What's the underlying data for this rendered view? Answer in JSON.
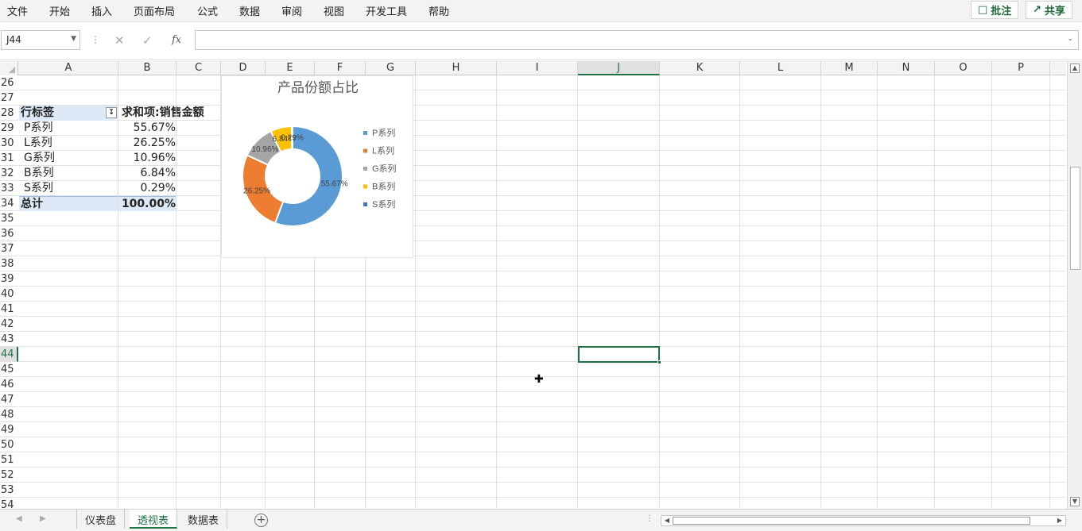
{
  "menu": {
    "items": [
      "文件",
      "开始",
      "插入",
      "页面布局",
      "公式",
      "数据",
      "审阅",
      "视图",
      "开发工具",
      "帮助"
    ],
    "comment_label": "批注",
    "share_label": "共享"
  },
  "formula_bar": {
    "name_box": "J44",
    "fx_label": "fx",
    "formula_value": ""
  },
  "columns": [
    "A",
    "B",
    "C",
    "D",
    "E",
    "F",
    "G",
    "H",
    "I",
    "J",
    "K",
    "L",
    "M",
    "N",
    "O",
    "P"
  ],
  "rows": [
    "26",
    "27",
    "28",
    "29",
    "30",
    "31",
    "32",
    "33",
    "34",
    "35",
    "36",
    "37",
    "38",
    "39",
    "40",
    "41",
    "42",
    "43",
    "44",
    "45",
    "46",
    "47",
    "48",
    "49",
    "50",
    "51",
    "52",
    "53",
    "54"
  ],
  "selected_cell": "J44",
  "pivot": {
    "header_row_label": "行标签",
    "header_value": "求和项:销售金额",
    "rows": [
      {
        "label": "P系列",
        "value": "55.67%"
      },
      {
        "label": "L系列",
        "value": "26.25%"
      },
      {
        "label": "G系列",
        "value": "10.96%"
      },
      {
        "label": "B系列",
        "value": "6.84%"
      },
      {
        "label": "S系列",
        "value": "0.29%"
      }
    ],
    "total_label": "总计",
    "total_value": "100.00%"
  },
  "chart_data": {
    "type": "pie",
    "donut": true,
    "title": "产品份额占比",
    "categories": [
      "P系列",
      "L系列",
      "G系列",
      "B系列",
      "S系列"
    ],
    "values": [
      55.67,
      26.25,
      10.96,
      6.84,
      0.29
    ],
    "data_labels": [
      "55.67%",
      "26.25%",
      "10.96%",
      "6.84%",
      "0.29%"
    ],
    "colors": [
      "#5b9bd5",
      "#ed7d31",
      "#a5a5a5",
      "#ffc000",
      "#4472c4"
    ],
    "legend": "right"
  },
  "sheets": {
    "tabs": [
      "仪表盘",
      "透视表",
      "数据表"
    ],
    "active": "透视表"
  }
}
